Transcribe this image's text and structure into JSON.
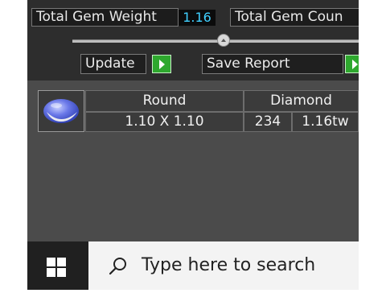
{
  "toolbar": {
    "total_gem_weight_label": "Total Gem Weight",
    "total_gem_weight_value": "1.16",
    "total_gem_count_label": "Total Gem Coun",
    "update_label": "Update",
    "save_report_label": "Save Report"
  },
  "gem_table": {
    "shape": "Round",
    "size": "1.10 X 1.10",
    "type": "Diamond",
    "count": "234",
    "weight": "1.16tw"
  },
  "taskbar": {
    "search_placeholder": "Type here to search"
  },
  "colors": {
    "accent_value": "#40d0ff",
    "button_arrow": "#2ea82e"
  }
}
